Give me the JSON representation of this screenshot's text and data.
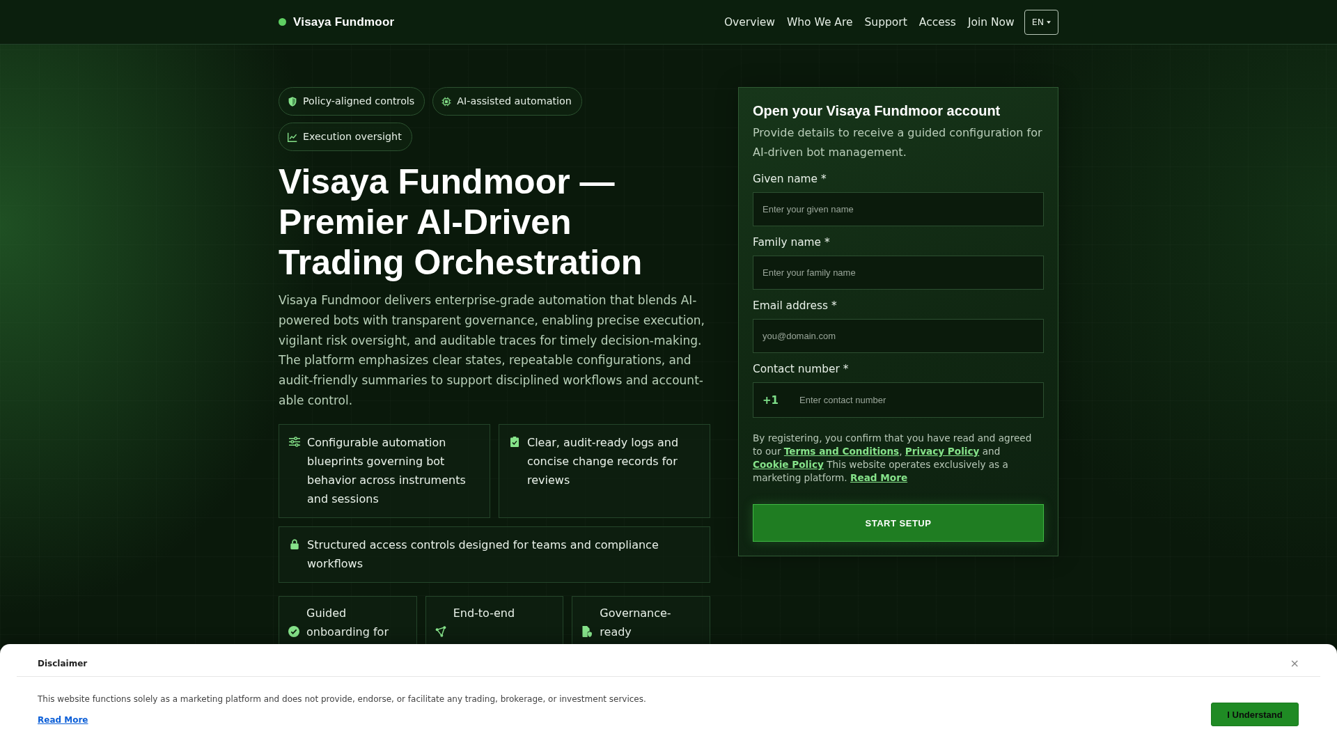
{
  "header": {
    "brand": "Visaya Fundmoor",
    "nav": [
      {
        "label": "Overview"
      },
      {
        "label": "Who We Are"
      },
      {
        "label": "Support"
      },
      {
        "label": "Access"
      },
      {
        "label": "Join Now"
      }
    ],
    "language": "EN"
  },
  "hero": {
    "pills": [
      "Policy-aligned controls",
      "AI-assisted automation",
      "Execution oversight"
    ],
    "title": "Visaya Fundmoor — Premier AI-Driven Trading Orchestration",
    "description": "Visaya Fundmoor delivers enterprise-grade automation that blends AI-powered bots with transparent governance, enabling precise execution, vigilant risk oversight, and auditable traces for timely decision-making. The platform emphasizes clear states, repeatable configurations, and audit-friendly summaries to support disciplined workflows and account-able control.",
    "features": [
      "Configurable automation blueprints governing bot behavior across instruments and sessions",
      "Clear, audit-ready logs and concise change records for reviews",
      "Structured access controls designed for teams and compliance workflows"
    ],
    "highlights": [
      "Guided onboarding for",
      "End-to-end",
      "Governance-ready"
    ]
  },
  "signup": {
    "title": "Open your Visaya Fundmoor account",
    "subtitle": "Provide details to receive a guided configuration for AI-driven bot management.",
    "fields": [
      {
        "kind": "text",
        "label": "Given name *",
        "placeholder": "Enter your given name"
      },
      {
        "kind": "text",
        "label": "Family name *",
        "placeholder": "Enter your family name"
      },
      {
        "kind": "email",
        "label": "Email address *",
        "placeholder": "you@domain.com"
      },
      {
        "kind": "phone",
        "label": "Contact number *",
        "prefix": "+1",
        "placeholder": "Enter contact number"
      }
    ],
    "consent": [
      {
        "kind": "text",
        "text": "By registering, you confirm that you have read and agreed to our "
      },
      {
        "kind": "link",
        "text": "Terms and Conditions"
      },
      {
        "kind": "text",
        "text": ", "
      },
      {
        "kind": "link",
        "text": "Privacy Policy"
      },
      {
        "kind": "text",
        "text": " and "
      },
      {
        "kind": "link",
        "text": "Cookie Policy"
      },
      {
        "kind": "text",
        "text": " This website operates exclusively as a marketing platform. "
      },
      {
        "kind": "link",
        "text": "Read More"
      }
    ],
    "submit": "START SETUP"
  },
  "disclaimer": {
    "title": "Disclaimer",
    "close": "×",
    "text": "This website functions solely as a marketing platform and does not provide, endorse, or facilitate any trading, brokerage, or investment services.",
    "link": "Read More",
    "accept": "I Understand"
  }
}
